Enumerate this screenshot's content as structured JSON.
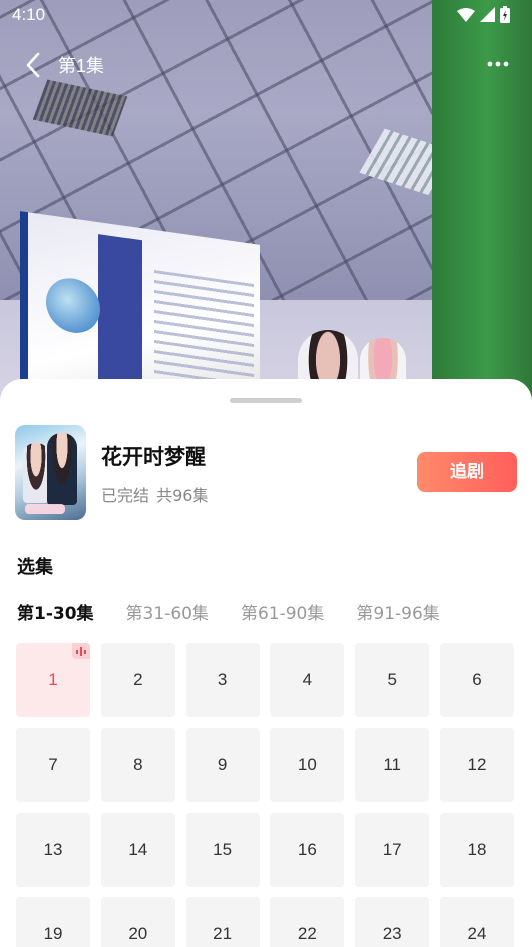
{
  "status_bar": {
    "time": "4:10"
  },
  "nav": {
    "episode_title": "第1集"
  },
  "drama": {
    "title": "花开时梦醒",
    "status": "已完结",
    "episode_count": "共96集",
    "follow_label": "追剧"
  },
  "selector": {
    "section_title": "选集",
    "ranges": [
      {
        "label": "第1-30集",
        "active": true
      },
      {
        "label": "第31-60集",
        "active": false
      },
      {
        "label": "第61-90集",
        "active": false
      },
      {
        "label": "第91-96集",
        "active": false
      }
    ],
    "episodes": [
      "1",
      "2",
      "3",
      "4",
      "5",
      "6",
      "7",
      "8",
      "9",
      "10",
      "11",
      "12",
      "13",
      "14",
      "15",
      "16",
      "17",
      "18",
      "19",
      "20",
      "21",
      "22",
      "23",
      "24"
    ],
    "current_episode": "1"
  },
  "colors": {
    "accent": "#ef4a52",
    "follow_gradient_start": "#ff8a6a",
    "follow_gradient_end": "#ff5f5b"
  }
}
